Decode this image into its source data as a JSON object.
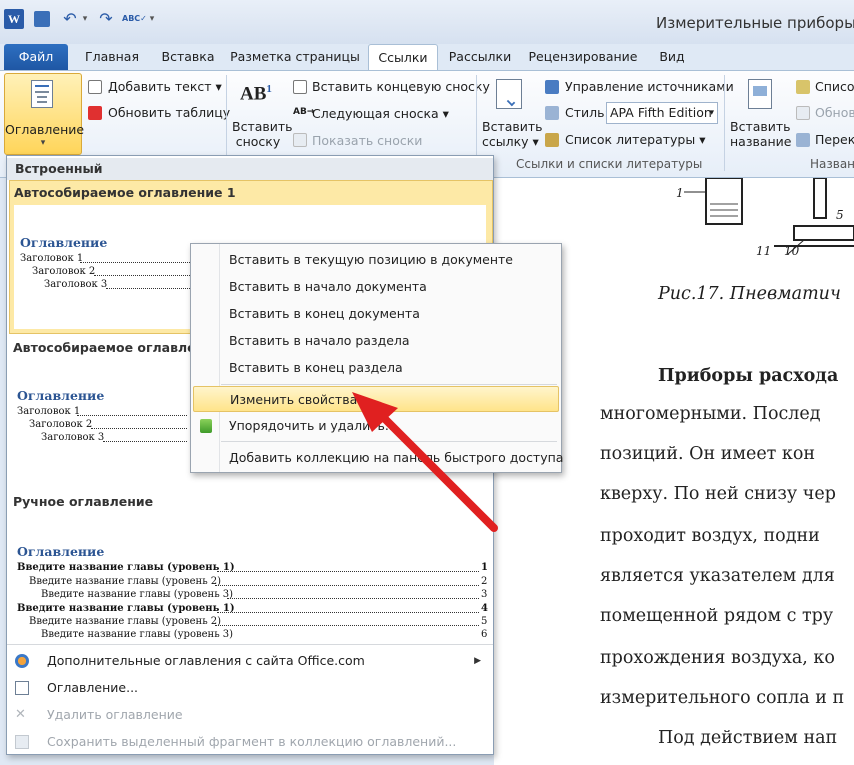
{
  "window": {
    "app_icon": "W",
    "title": "Измерительные приборы [F"
  },
  "tabs": [
    "Файл",
    "Главная",
    "Вставка",
    "Разметка страницы",
    "Ссылки",
    "Рассылки",
    "Рецензирование",
    "Вид"
  ],
  "ribbon": {
    "toc_button": "Оглавление",
    "add_text": "Добавить текст",
    "update_table": "Обновить таблицу",
    "insert_footnote_line1": "Вставить",
    "insert_footnote_line2": "сноску",
    "footnote_glyph": "AB",
    "footnote_sup": "1",
    "insert_endnote": "Вставить концевую сноску",
    "next_footnote": "Следующая сноска",
    "show_notes": "Показать сноски",
    "insert_citation_line1": "Вставить",
    "insert_citation_line2": "ссылку",
    "manage_sources": "Управление источниками",
    "style_label": "Стиль:",
    "style_value": "APA Fifth Edition",
    "bibliography": "Список литературы",
    "group_citations": "Ссылки и списки литературы",
    "insert_caption_line1": "Вставить",
    "insert_caption_line2": "название",
    "list_truncated": "Список",
    "update_truncated": "Обнов",
    "cross_truncated": "Перек",
    "group_captions": "Назван"
  },
  "panel": {
    "section_builtin": "Встроенный",
    "auto1_title": "Автособираемое оглавление 1",
    "auto2_title": "Автособираемое оглавлени",
    "manual_title": "Ручное оглавление",
    "preview_heading": "Оглавление",
    "preview_entries": [
      "Заголовок 1",
      "Заголовок 2",
      "Заголовок 3"
    ],
    "preview_pages": [
      "1",
      "1",
      "1"
    ],
    "manual_entries": [
      "Введите название главы (уровень 1)",
      "Введите название главы (уровень 2)",
      "Введите название главы (уровень 3)",
      "Введите название главы (уровень 1)",
      "Введите название главы (уровень 2)",
      "Введите название главы (уровень 3)"
    ],
    "manual_pages": [
      "1",
      "2",
      "3",
      "4",
      "5",
      "6"
    ],
    "more_toc": "Дополнительные оглавления с сайта Office.com",
    "toc_dialog": "Оглавление...",
    "remove_toc": "Удалить оглавление",
    "save_selection": "Сохранить выделенный фрагмент в коллекцию оглавлений..."
  },
  "context_menu": {
    "items": [
      "Вставить в текущую позицию в документе",
      "Вставить в начало документа",
      "Вставить в конец документа",
      "Вставить в начало раздела",
      "Вставить в конец раздела",
      "Изменить свойства...",
      "Упорядочить и удалить...",
      "Добавить коллекцию на панель быстрого доступа"
    ]
  },
  "document": {
    "fig_labels": [
      "1",
      "11",
      "10",
      "5"
    ],
    "caption": "Рис.17. Пневматич",
    "lines": [
      "Приборы расхода",
      "многомерными. Послед",
      "позиций. Он имеет кон",
      "кверху. По ней снизу чер",
      "проходит воздух, подни",
      "является указателем для",
      "помещенной рядом с тру",
      "прохождения воздуха, ко",
      "измерительного сопла и п",
      "Под действием нап"
    ]
  },
  "colors": {
    "accent_blue": "#2c5593",
    "file_tab": "#1f57a4",
    "highlight": "#ffe48a",
    "arrow": "#e02020"
  }
}
